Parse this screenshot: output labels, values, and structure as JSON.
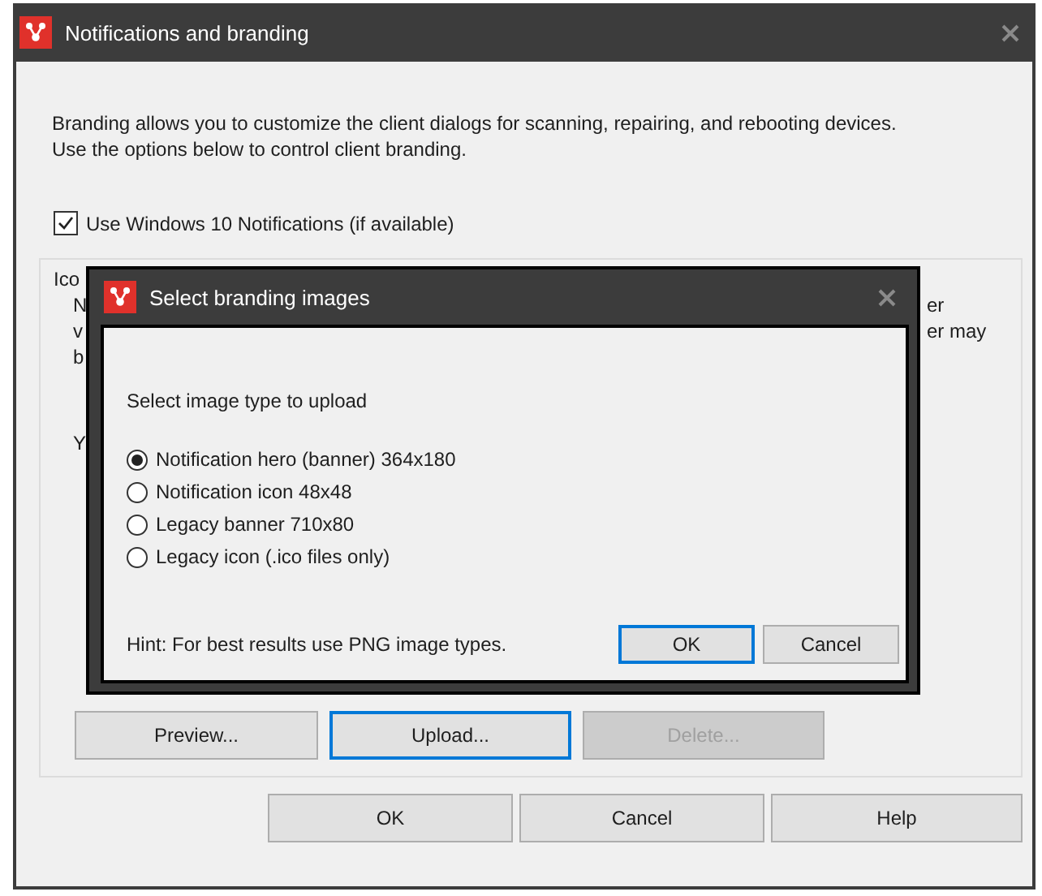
{
  "window": {
    "title": "Notifications and branding"
  },
  "intro": [
    "Branding allows you to customize the client dialogs for scanning, repairing, and rebooting devices.",
    "Use the options below to control client branding."
  ],
  "windows_notifications": {
    "label": "Use Windows 10 Notifications (if available)",
    "checked": true
  },
  "group": {
    "label": "Ico",
    "left_fragments": [
      "N",
      "v",
      "b",
      "Y"
    ],
    "right_fragments": [
      "er",
      "er may"
    ],
    "buttons": [
      {
        "label": "Preview...",
        "focused": false,
        "disabled": false
      },
      {
        "label": "Upload...",
        "focused": true,
        "disabled": false
      },
      {
        "label": "Delete...",
        "focused": false,
        "disabled": true
      }
    ]
  },
  "footer_buttons": [
    "OK",
    "Cancel",
    "Help"
  ],
  "dialog": {
    "title": "Select branding images",
    "prompt": "Select image type to upload",
    "options": [
      {
        "label": "Notification hero (banner) 364x180",
        "selected": true
      },
      {
        "label": "Notification icon 48x48",
        "selected": false
      },
      {
        "label": "Legacy banner 710x80",
        "selected": false
      },
      {
        "label": "Legacy icon (.ico files only)",
        "selected": false
      }
    ],
    "hint": "Hint: For best results use PNG image types.",
    "buttons": [
      {
        "label": "OK",
        "focused": true
      },
      {
        "label": "Cancel",
        "focused": false
      }
    ]
  }
}
